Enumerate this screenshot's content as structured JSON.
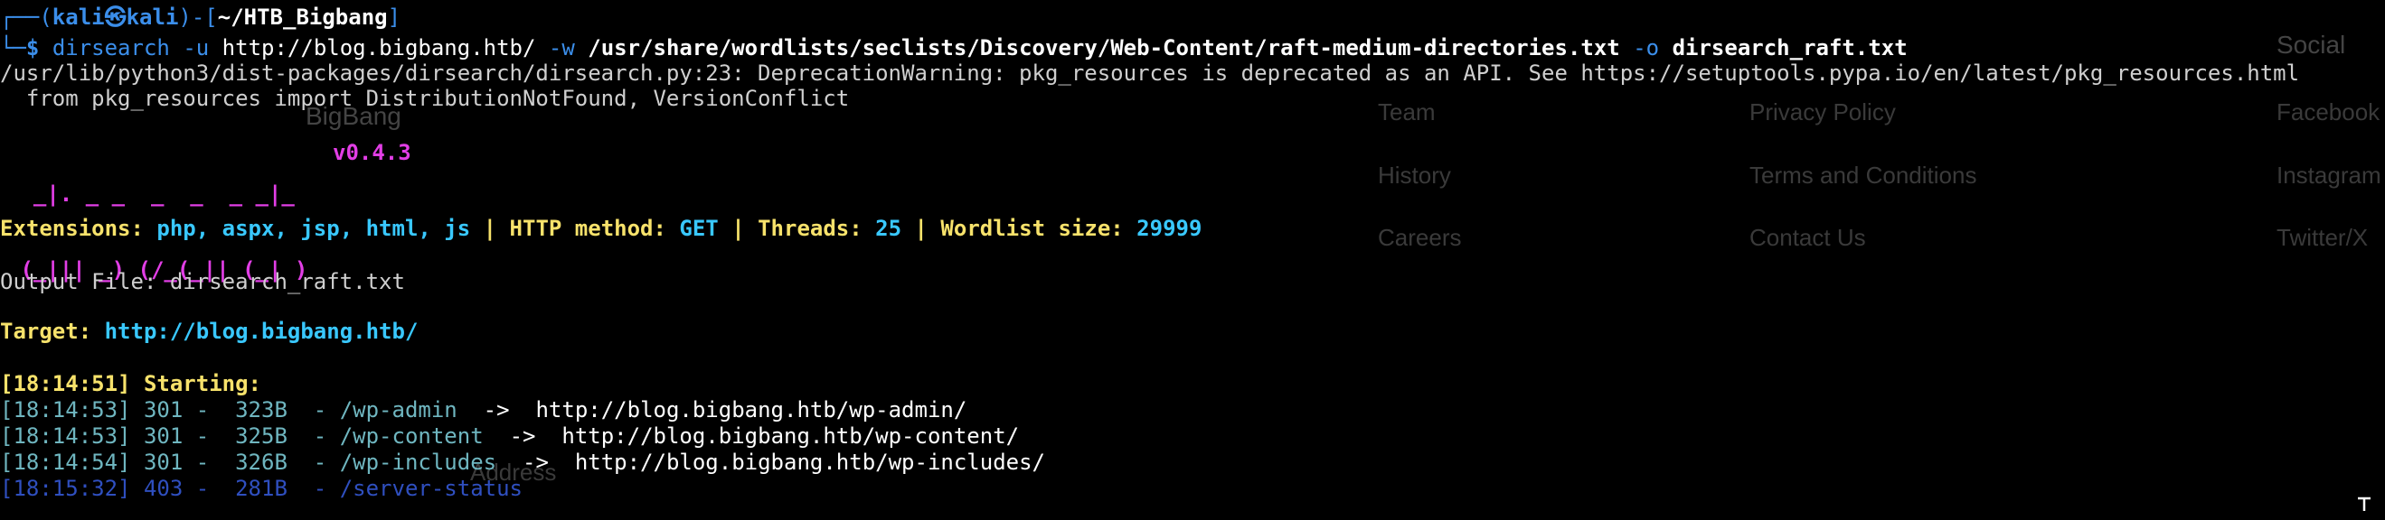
{
  "background_site": {
    "social_heading": "Social",
    "brand": "BigBang",
    "links_col1": [
      "Team",
      "History",
      "Careers"
    ],
    "links_col2": [
      "Privacy Policy",
      "Terms and Conditions",
      "Contact Us"
    ],
    "links_col3": [
      "Facebook",
      "Instagram",
      "Twitter/X"
    ],
    "footer_fragment": "Address"
  },
  "prompt": {
    "corner": "┌──(",
    "user": "kali",
    "skull": "㉿",
    "host": "kali",
    "sep": ")-[",
    "path": "~/HTB_Bigbang",
    "close": "]",
    "second_line_prefix": "└─",
    "dollar": "$"
  },
  "command": {
    "name": "dirsearch",
    "flag_u": "-u",
    "url": "http://blog.bigbang.htb/",
    "flag_w": "-w",
    "wordlist": "/usr/share/wordlists/seclists/Discovery/Web-Content/raft-medium-directories.txt",
    "flag_o": "-o",
    "output": "dirsearch_raft.txt"
  },
  "warning": {
    "line1": "/usr/lib/python3/dist-packages/dirsearch/dirsearch.py:23: DeprecationWarning: pkg_resources is deprecated as an API. See https://setuptools.pypa.io/en/latest/pkg_resources.html",
    "line2": "  from pkg_resources import DistributionNotFound, VersionConflict"
  },
  "banner": {
    "art_line1": "  _|. _ _  _  _  _ _|_",
    "art_line2": " (_||| _) (/_(_|| (_| )",
    "version": "v0.4.3"
  },
  "config": {
    "extensions_label": "Extensions:",
    "extensions_value": "php, aspx, jsp, html, js",
    "method_label": "HTTP method:",
    "method_value": "GET",
    "threads_label": "Threads:",
    "threads_value": "25",
    "wordlist_label": "Wordlist size:",
    "wordlist_value": "29999",
    "separator": "|"
  },
  "output_file": {
    "label": "Output File:",
    "value": "dirsearch_raft.txt"
  },
  "target": {
    "label": "Target:",
    "value": "http://blog.bigbang.htb/"
  },
  "starting": {
    "time": "[18:14:51]",
    "text": "Starting:"
  },
  "results": [
    {
      "time": "[18:14:53]",
      "status": "301",
      "size": "323B",
      "path": "/wp-admin",
      "arrow": "->",
      "redirect": "http://blog.bigbang.htb/wp-admin/"
    },
    {
      "time": "[18:14:53]",
      "status": "301",
      "size": "325B",
      "path": "/wp-content",
      "arrow": "->",
      "redirect": "http://blog.bigbang.htb/wp-content/"
    },
    {
      "time": "[18:14:54]",
      "status": "301",
      "size": "326B",
      "path": "/wp-includes",
      "arrow": "->",
      "redirect": "http://blog.bigbang.htb/wp-includes/"
    },
    {
      "time": "[18:15:32]",
      "status": "403",
      "size": "281B",
      "path": "/server-status",
      "arrow": "",
      "redirect": ""
    }
  ],
  "colors": {
    "background": "#000000",
    "prompt_blue": "#3b8eea",
    "magenta": "#e23ee6",
    "yellow": "#f7e26b",
    "cyan": "#39c8ff",
    "teal": "#6fb6c0"
  },
  "icons": {
    "resize": "resize-grip-icon"
  }
}
